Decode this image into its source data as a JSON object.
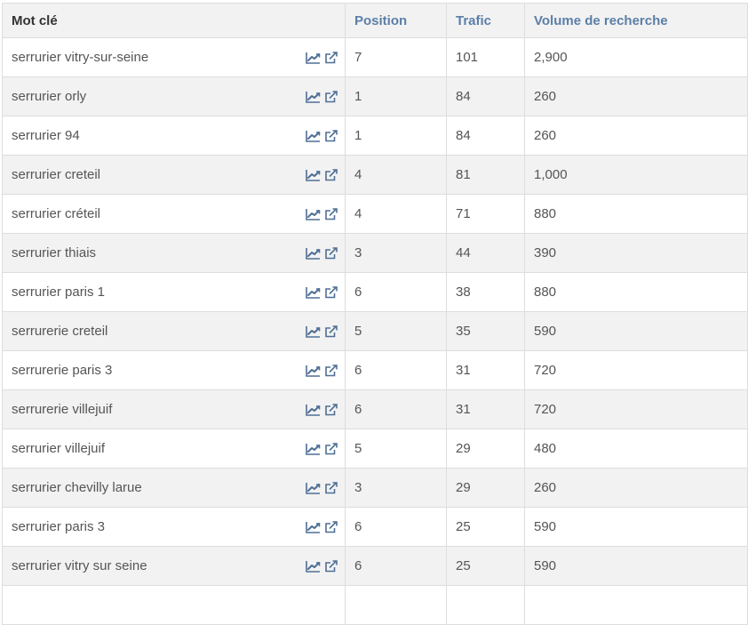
{
  "colors": {
    "header_bg": "#f2f2f2",
    "header_link": "#5b7fa8",
    "icon": "#4f6f96",
    "border": "#dddddd"
  },
  "header": {
    "keyword": "Mot clé",
    "position": "Position",
    "traffic": "Trafic",
    "volume": "Volume de recherche"
  },
  "row_icons": [
    "trend-chart-icon",
    "external-link-icon"
  ],
  "rows": [
    {
      "keyword": "serrurier vitry-sur-seine",
      "position": "7",
      "traffic": "101",
      "volume": "2,900"
    },
    {
      "keyword": "serrurier orly",
      "position": "1",
      "traffic": "84",
      "volume": "260"
    },
    {
      "keyword": "serrurier 94",
      "position": "1",
      "traffic": "84",
      "volume": "260"
    },
    {
      "keyword": "serrurier creteil",
      "position": "4",
      "traffic": "81",
      "volume": "1,000"
    },
    {
      "keyword": "serrurier créteil",
      "position": "4",
      "traffic": "71",
      "volume": "880"
    },
    {
      "keyword": "serrurier thiais",
      "position": "3",
      "traffic": "44",
      "volume": "390"
    },
    {
      "keyword": "serrurier paris 1",
      "position": "6",
      "traffic": "38",
      "volume": "880"
    },
    {
      "keyword": "serrurerie creteil",
      "position": "5",
      "traffic": "35",
      "volume": "590"
    },
    {
      "keyword": "serrurerie paris 3",
      "position": "6",
      "traffic": "31",
      "volume": "720"
    },
    {
      "keyword": "serrurerie villejuif",
      "position": "6",
      "traffic": "31",
      "volume": "720"
    },
    {
      "keyword": "serrurier villejuif",
      "position": "5",
      "traffic": "29",
      "volume": "480"
    },
    {
      "keyword": "serrurier chevilly larue",
      "position": "3",
      "traffic": "29",
      "volume": "260"
    },
    {
      "keyword": "serrurier paris 3",
      "position": "6",
      "traffic": "25",
      "volume": "590"
    },
    {
      "keyword": "serrurier vitry sur seine",
      "position": "6",
      "traffic": "25",
      "volume": "590"
    },
    {
      "keyword": "",
      "position": "",
      "traffic": "",
      "volume": ""
    }
  ]
}
